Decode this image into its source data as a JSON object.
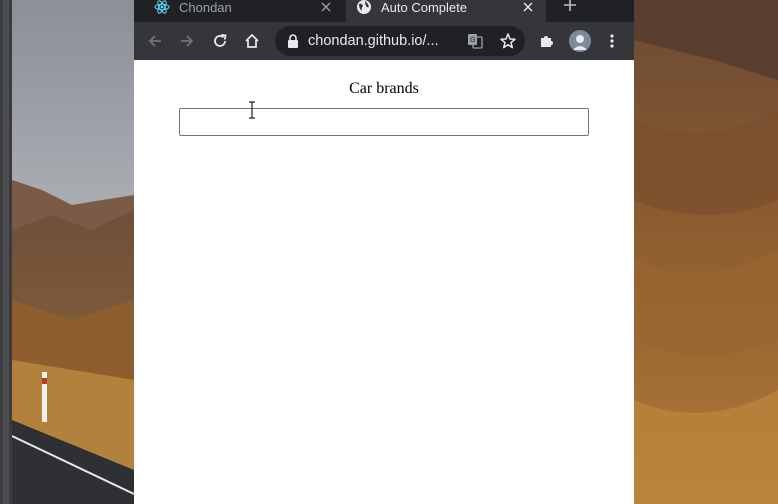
{
  "browser": {
    "tabs": [
      {
        "title": "Chondan",
        "active": false,
        "favicon": "react-icon"
      },
      {
        "title": "Auto Complete",
        "active": true,
        "favicon": "globe-icon"
      }
    ],
    "address_bar": {
      "url": "chondan.github.io/..."
    }
  },
  "page": {
    "label": "Car brands",
    "search": {
      "value": "",
      "placeholder": ""
    }
  },
  "colors": {
    "tabstrip": "#202124",
    "toolbar": "#35363a",
    "omnibox": "#202124",
    "text_light": "#e8eaed"
  }
}
